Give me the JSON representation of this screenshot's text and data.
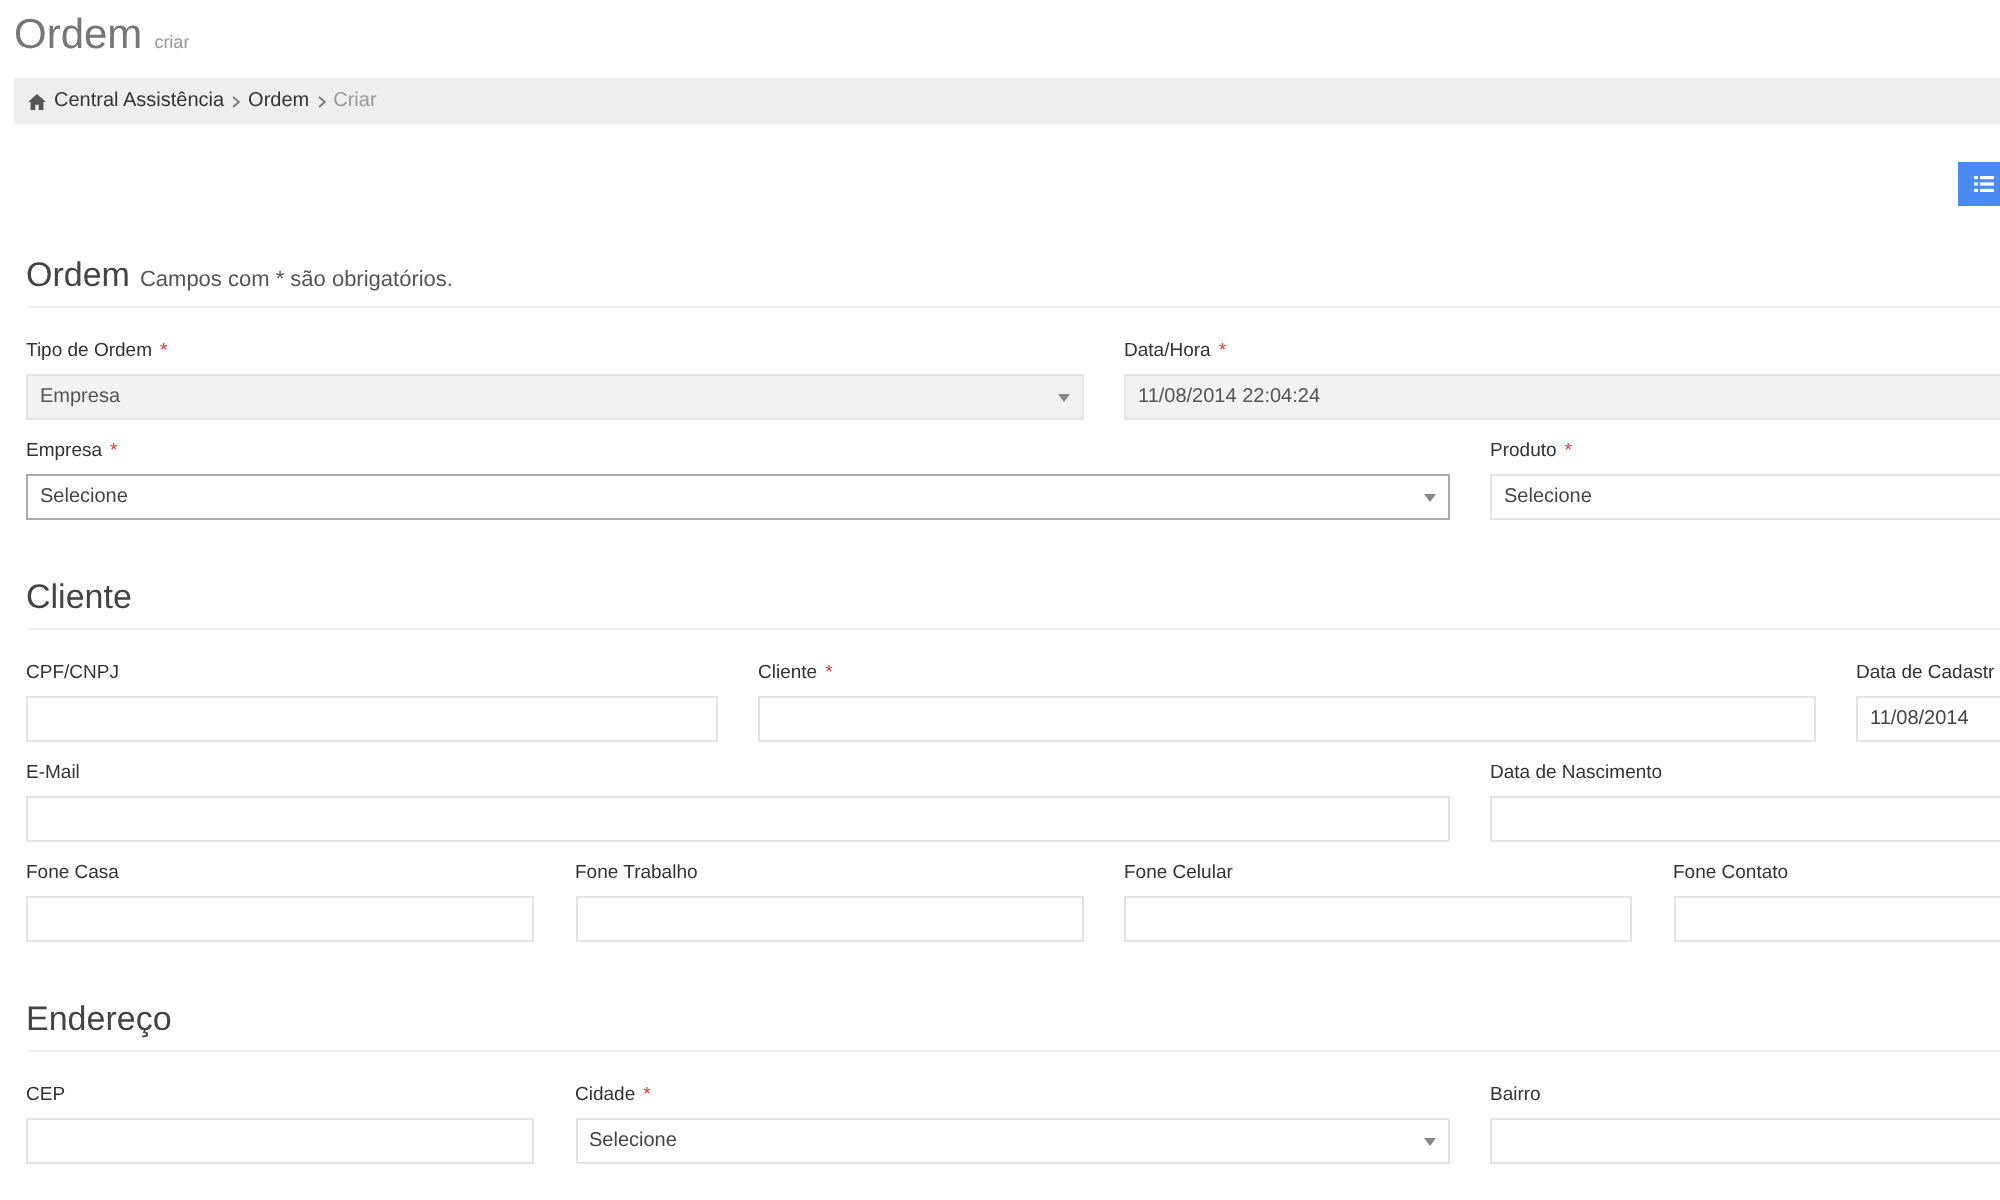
{
  "page": {
    "title": "Ordem",
    "subtitle": "criar"
  },
  "breadcrumb": [
    {
      "label": "Central Assistência",
      "current": false
    },
    {
      "label": "Ordem",
      "current": false
    },
    {
      "label": "Criar",
      "current": true
    }
  ],
  "sections": [
    {
      "title": "Ordem",
      "note": "Campos com * são obrigatórios.",
      "rows": [
        [
          {
            "label": "Tipo de Ordem",
            "mark": "*",
            "kind": "select",
            "value": "Empresa",
            "disabled": true,
            "focused": false
          },
          {
            "label": "Data/Hora",
            "mark": "*",
            "kind": "text",
            "value": "11/08/2014 22:04:24",
            "disabled": true,
            "focused": false
          }
        ],
        [
          {
            "label": "Empresa",
            "mark": "*",
            "kind": "select",
            "value": "Selecione",
            "disabled": false,
            "focused": true
          },
          {
            "label": "Produto",
            "mark": "*",
            "kind": "text",
            "value": "Selecione",
            "disabled": false,
            "focused": false
          }
        ]
      ]
    },
    {
      "title": "Cliente",
      "rows": [
        [
          {
            "label": "CPF/CNPJ",
            "kind": "text",
            "disabled": false,
            "focused": false
          },
          {
            "label": "Cliente",
            "mark": "*",
            "kind": "text",
            "disabled": false,
            "focused": false
          },
          {
            "label": "Data de Cadastr",
            "kind": "text",
            "value": "11/08/2014",
            "disabled": false,
            "focused": false
          }
        ],
        [
          {
            "label": "E-Mail",
            "kind": "text",
            "disabled": false,
            "focused": false
          },
          {
            "label": "Data de Nascimento",
            "kind": "text",
            "disabled": false,
            "focused": false
          }
        ],
        [
          {
            "label": "Fone Casa",
            "kind": "text",
            "disabled": false,
            "focused": false
          },
          {
            "label": "Fone Trabalho",
            "kind": "text",
            "disabled": false,
            "focused": false
          },
          {
            "label": "Fone Celular",
            "kind": "text",
            "disabled": false,
            "focused": false
          },
          {
            "label": "Fone Contato",
            "kind": "text",
            "disabled": false,
            "focused": false
          }
        ]
      ]
    },
    {
      "title": "Endereço",
      "rows": [
        [
          {
            "label": "CEP",
            "kind": "text",
            "disabled": false,
            "focused": false
          },
          {
            "label": "Cidade",
            "mark": "*",
            "kind": "select",
            "value": "Selecione",
            "disabled": false,
            "focused": false
          },
          {
            "label": "Bairro",
            "kind": "text",
            "disabled": false,
            "focused": false
          }
        ]
      ]
    }
  ]
}
